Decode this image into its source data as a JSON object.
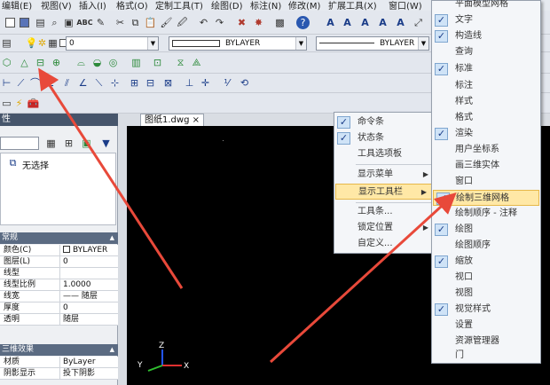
{
  "menubar": [
    "编辑(E)",
    "视图(V)",
    "插入(I)",
    "格式(O)",
    "定制工具(T)",
    "绘图(D)",
    "标注(N)",
    "修改(M)",
    "扩展工具(X)",
    "窗口(W)"
  ],
  "layer_combo": "0",
  "linetype_combo": "BYLAYER",
  "lineweight_combo": "BYLAYER",
  "colors": {
    "accent": "#1a3c88",
    "highlight": "#ffe8a6",
    "panel_title": "#46556b",
    "arrow": "#e8493a"
  },
  "panel": {
    "title": "性",
    "selection_label": "无选择",
    "sections": {
      "general": "常规",
      "three_d": "三维效果"
    },
    "rows_general": [
      {
        "key": "颜色(C)",
        "value": "BYLAYER"
      },
      {
        "key": "图层(L)",
        "value": "0"
      },
      {
        "key": "线型",
        "value": ""
      },
      {
        "key": "线型比例",
        "value": "1.0000"
      },
      {
        "key": "线宽",
        "value": "—— 随层"
      },
      {
        "key": "厚度",
        "value": "0"
      },
      {
        "key": "透明",
        "value": "随层"
      }
    ],
    "rows_3d": [
      {
        "key": "材质",
        "value": "ByLayer"
      },
      {
        "key": "阴影显示",
        "value": "投下阴影"
      }
    ]
  },
  "tab": {
    "label": "图纸1.dwg",
    "close": "×"
  },
  "axis": {
    "z": "Z",
    "x": "X",
    "y": "Y"
  },
  "context_menu": [
    {
      "label": "命令条",
      "checked": true
    },
    {
      "label": "状态条",
      "checked": true
    },
    {
      "label": "工具选项板",
      "checked": false
    },
    {
      "label": "显示菜单",
      "checked": false,
      "submenu": true
    },
    {
      "label": "显示工具栏",
      "checked": false,
      "submenu": true,
      "highlighted": true
    },
    {
      "label": "工具条...",
      "checked": false
    },
    {
      "label": "锁定位置",
      "checked": false,
      "submenu": true
    },
    {
      "label": "自定义...",
      "checked": false
    }
  ],
  "toolbar_menu": [
    {
      "label": "平面模型网格",
      "checked": false
    },
    {
      "label": "文字",
      "checked": true
    },
    {
      "label": "构造线",
      "checked": true
    },
    {
      "label": "查询",
      "checked": false
    },
    {
      "label": "标准",
      "checked": true
    },
    {
      "label": "标注",
      "checked": false
    },
    {
      "label": "样式",
      "checked": false
    },
    {
      "label": "格式",
      "checked": false
    },
    {
      "label": "渲染",
      "checked": true
    },
    {
      "label": "用户坐标系",
      "checked": false
    },
    {
      "label": "画三维实体",
      "checked": false
    },
    {
      "label": "窗口",
      "checked": false
    },
    {
      "label": "绘制三维网格",
      "checked": true,
      "highlighted": true
    },
    {
      "label": "绘制顺序 - 注释",
      "checked": false
    },
    {
      "label": "绘图",
      "checked": true
    },
    {
      "label": "绘图顺序",
      "checked": false
    },
    {
      "label": "缩放",
      "checked": true
    },
    {
      "label": "视口",
      "checked": false
    },
    {
      "label": "视图",
      "checked": false
    },
    {
      "label": "视觉样式",
      "checked": true
    },
    {
      "label": "设置",
      "checked": false
    },
    {
      "label": "资源管理器",
      "checked": false
    },
    {
      "label": "门",
      "checked": false
    }
  ]
}
